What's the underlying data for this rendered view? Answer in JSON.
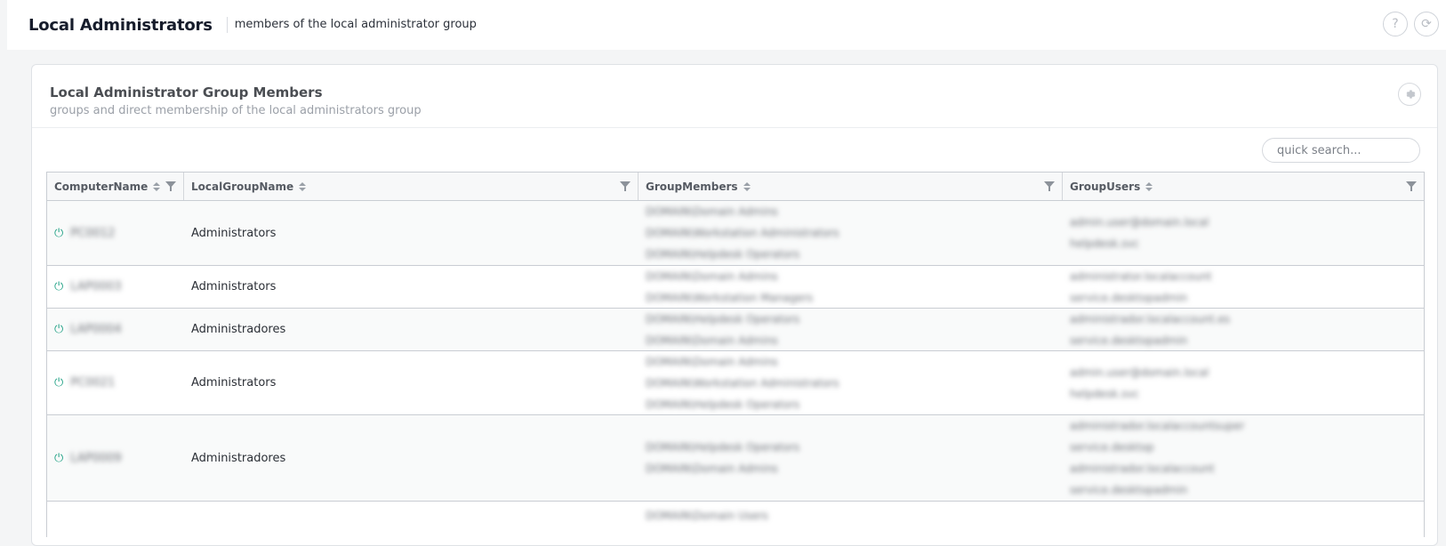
{
  "header": {
    "title": "Local Administrators",
    "subtitle": "members of the local administrator group",
    "help_icon": "question-icon",
    "refresh_icon": "refresh-icon"
  },
  "card": {
    "title": "Local Administrator Group Members",
    "subtitle": "groups and direct membership of the local administrators group",
    "settings_icon": "gear-icon"
  },
  "search": {
    "placeholder": "quick search..."
  },
  "table": {
    "columns": [
      "ComputerName",
      "LocalGroupName",
      "GroupMembers",
      "GroupUsers"
    ],
    "rows": [
      {
        "computer": "PC0012",
        "group": "Administrators",
        "members": [
          "DOMAIN\\Domain Admins",
          "DOMAIN\\Workstation Administrators",
          "DOMAIN\\Helpdesk Operators"
        ],
        "users": [
          "admin.user@domain.local",
          "helpdesk.svc"
        ]
      },
      {
        "computer": "LAP0003",
        "group": "Administrators",
        "members": [
          "DOMAIN\\Domain Admins",
          "DOMAIN\\Workstation Managers"
        ],
        "users": [
          "administrator.localaccount",
          "service.desktopadmin"
        ]
      },
      {
        "computer": "LAP0004",
        "group": "Administradores",
        "members": [
          "DOMAIN\\Helpdesk Operators",
          "DOMAIN\\Domain Admins"
        ],
        "users": [
          "administrador.localaccount.es",
          "service.desktopadmin"
        ]
      },
      {
        "computer": "PC0021",
        "group": "Administrators",
        "members": [
          "DOMAIN\\Domain Admins",
          "DOMAIN\\Workstation Administrators",
          "DOMAIN\\Helpdesk Operators"
        ],
        "users": [
          "admin.user@domain.local",
          "helpdesk.svc"
        ]
      },
      {
        "computer": "LAP0009",
        "group": "Administradores",
        "members": [
          "DOMAIN\\Helpdesk Operators",
          "DOMAIN\\Domain Admins"
        ],
        "users": [
          "administrador.localaccountsuper",
          "service.desktop",
          "administrador.localaccount",
          "service.desktopadmin"
        ]
      },
      {
        "computer": "",
        "group": "",
        "members": [
          "DOMAIN\\Domain Users"
        ],
        "users": []
      }
    ]
  },
  "colors": {
    "power_icon": "#2aa58a"
  }
}
